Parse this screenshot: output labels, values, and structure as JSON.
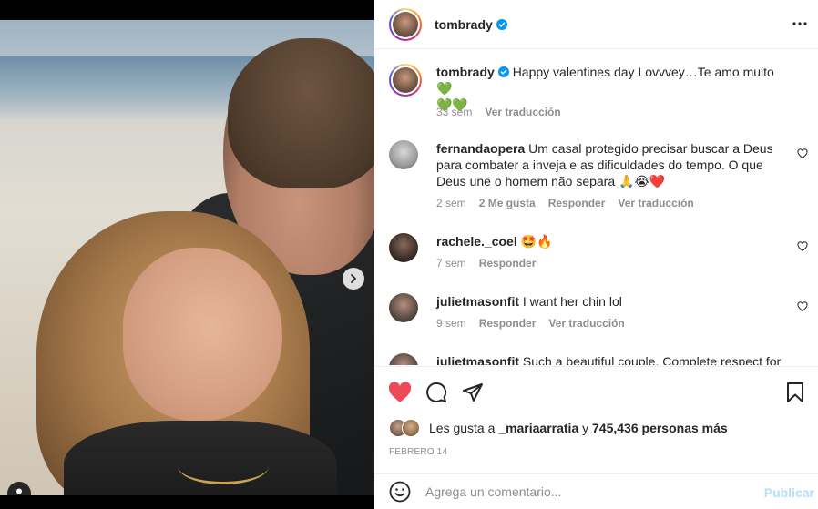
{
  "post": {
    "username": "tombrady",
    "verified_icon": "verified-badge-icon"
  },
  "media": {
    "carousel_count": 2,
    "active_index": 0
  },
  "caption": {
    "username": "tombrady",
    "text": "Happy valentines day Lovvvey…Te amo muito 💚",
    "text_line2": "💚💚",
    "time": "33 sem",
    "translate": "Ver traducción"
  },
  "comments": [
    {
      "username": "fernandaopera",
      "text": "Um casal protegido precisar buscar a Deus",
      "text_line2": "para combater a inveja e as dificuldades do tempo. O que",
      "text_line3": "Deus une o homem não separa 🙏😭❤️",
      "time": "2 sem",
      "likes": "2 Me gusta",
      "reply": "Responder",
      "translate": "Ver traducción"
    },
    {
      "username": "rachele._coel",
      "text": "🤩🔥",
      "time": "7 sem",
      "reply": "Responder"
    },
    {
      "username": "julietmasonfit",
      "text": "I want her chin lol",
      "time": "9 sem",
      "reply": "Responder",
      "translate": "Ver traducción"
    },
    {
      "username": "julietmasonfit",
      "text": "Such a beautiful couple. Complete respect for"
    }
  ],
  "likes": {
    "prefix": "Les gusta a",
    "user": "_mariaarratia",
    "joiner": "y",
    "others": "745,436 personas más"
  },
  "date": "FEBRERO 14",
  "add_comment": {
    "placeholder": "Agrega un comentario...",
    "publish": "Publicar"
  },
  "colors": {
    "like_red": "#ed4956",
    "link_blue": "#0095f6",
    "publish_disabled": "#b2dffc",
    "muted": "#8e8e8e"
  }
}
